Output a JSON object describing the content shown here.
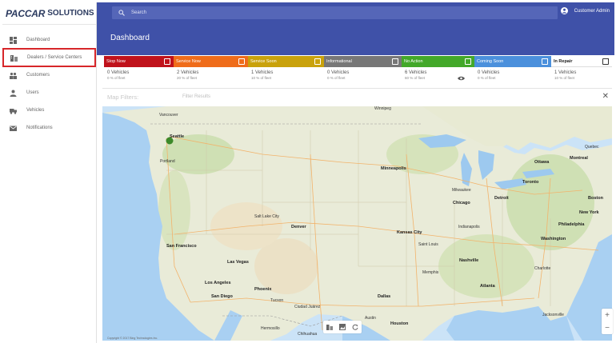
{
  "brand": {
    "name": "PACCAR",
    "suffix": "SOLUTIONS"
  },
  "sidebar": {
    "items": [
      {
        "label": "Dashboard",
        "icon": "dashboard-icon"
      },
      {
        "label": "Dealers / Service Centers",
        "icon": "building-icon"
      },
      {
        "label": "Customers",
        "icon": "customers-icon"
      },
      {
        "label": "Users",
        "icon": "user-icon"
      },
      {
        "label": "Vehicles",
        "icon": "truck-icon"
      },
      {
        "label": "Notifications",
        "icon": "mail-icon"
      }
    ]
  },
  "topbar": {
    "search_placeholder": "Search",
    "user": "Customer Admin"
  },
  "page": {
    "title": "Dashboard"
  },
  "status_tabs": [
    {
      "label": "Stop Now",
      "count": "0 Vehicles",
      "pct": "0 % of fleet",
      "color": "#c0121b"
    },
    {
      "label": "Service Now",
      "count": "2 Vehicles",
      "pct": "20 % of fleet",
      "color": "#ef6c1a"
    },
    {
      "label": "Service Soon",
      "count": "1 Vehicles",
      "pct": "10 % of fleet",
      "color": "#c9a20c"
    },
    {
      "label": "Informational",
      "count": "0 Vehicles",
      "pct": "0 % of fleet",
      "color": "#777777"
    },
    {
      "label": "No Action",
      "count": "6 Vehicles",
      "pct": "60 % of fleet",
      "color": "#43a829"
    },
    {
      "label": "Coming Soon",
      "count": "0 Vehicles",
      "pct": "0 % of fleet",
      "color": "#4b90dc"
    },
    {
      "label": "In Repair",
      "count": "1 Vehicles",
      "pct": "10 % of fleet",
      "color": "#ffffff"
    }
  ],
  "filters": {
    "label": "Map Filters:",
    "placeholder": "Filter Results"
  },
  "map": {
    "cities": {
      "vancouver": "Vancouver",
      "seattle": "Seattle",
      "portland": "Portland",
      "winnipeg": "Winnipeg",
      "minneapolis": "Minneapolis",
      "toronto": "Toronto",
      "ottawa": "Ottawa",
      "montreal": "Montreal",
      "quebec": "Quebec",
      "chicago": "Chicago",
      "milwaukee": "Milwaukee",
      "detroit": "Detroit",
      "boston": "Boston",
      "new_york": "New York",
      "philadelphia": "Philadelphia",
      "washington": "Washington",
      "denver": "Denver",
      "salt_lake_city": "Salt Lake City",
      "kansas_city": "Kansas City",
      "saint_louis": "Saint Louis",
      "indianapolis": "Indianapolis",
      "nashville": "Nashville",
      "memphis": "Memphis",
      "atlanta": "Atlanta",
      "charlotte": "Charlotte",
      "san_francisco": "San Francisco",
      "las_vegas": "Las Vegas",
      "los_angeles": "Los Angeles",
      "san_diego": "San Diego",
      "phoenix": "Phoenix",
      "tucson": "Tucson",
      "dallas": "Dallas",
      "houston": "Houston",
      "austin": "Austin",
      "jacksonville": "Jacksonville",
      "ciudad_juarez": "Ciudad Juárez",
      "hermosillo": "Hermosillo",
      "chihuahua": "Chihuahua"
    },
    "attribution": "Copyright © 2017 Bing Technologies Inc."
  },
  "colors": {
    "primary": "#3f51a8",
    "highlight": "#d7262a",
    "fleet_marker": "#3d8a2a"
  }
}
